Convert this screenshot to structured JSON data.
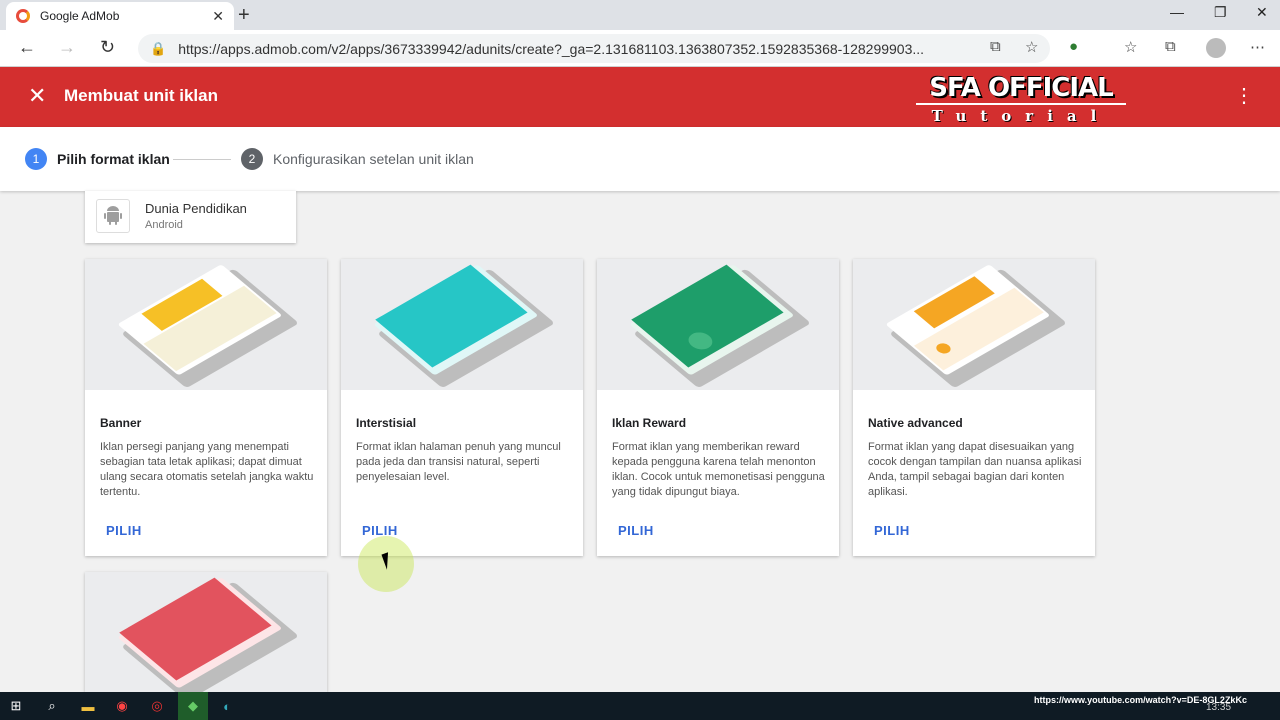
{
  "browser": {
    "tab_title": "Google AdMob",
    "tab_close": "✕",
    "new_tab": "+",
    "url": "https://apps.admob.com/v2/apps/3673339942/adunits/create?_ga=2.131681103.1363807352.1592835368-128299903...",
    "window_controls": [
      "—",
      "❐",
      "✕"
    ]
  },
  "header": {
    "close_label": "✕",
    "title": "Membuat unit iklan",
    "more_label": "⋮",
    "watermark_main": "SFA OFFICIAL",
    "watermark_sub": "Tutorial"
  },
  "stepper": {
    "steps": [
      {
        "number": "1",
        "label": "Pilih format iklan"
      },
      {
        "number": "2",
        "label": "Konfigurasikan setelan unit iklan"
      }
    ]
  },
  "app": {
    "name": "Dunia Pendidikan",
    "platform": "Android"
  },
  "cards": [
    {
      "title": "Banner",
      "description": "Iklan persegi panjang yang menempati sebagian tata letak aplikasi; dapat dimuat ulang secara otomatis setelah jangka waktu tertentu.",
      "action": "PILIH",
      "accent": "#f6c026"
    },
    {
      "title": "Interstisial",
      "description": "Format iklan halaman penuh yang muncul pada jeda dan transisi natural, seperti penyelesaian level.",
      "action": "PILIH",
      "accent": "#26c6c6"
    },
    {
      "title": "Iklan Reward",
      "description": "Format iklan yang memberikan reward kepada pengguna karena telah menonton iklan. Cocok untuk memonetisasi pengguna yang tidak dipungut biaya.",
      "action": "PILIH",
      "accent": "#1e9e6a"
    },
    {
      "title": "Native advanced",
      "description": "Format iklan yang dapat disesuaikan yang cocok dengan tampilan dan nuansa aplikasi Anda, tampil sebagai bagian dari konten aplikasi.",
      "action": "PILIH",
      "accent": "#f5a623"
    }
  ],
  "partial_card": {
    "accent": "#e2535e"
  },
  "taskbar": {
    "url_text": "https://www.youtube.com/watch?v=DE-8GL2ZkKc",
    "time": "13:35"
  },
  "colors": {
    "header_red": "#d32f2f",
    "step_active": "#4285f4",
    "link_blue": "#3367d6"
  }
}
